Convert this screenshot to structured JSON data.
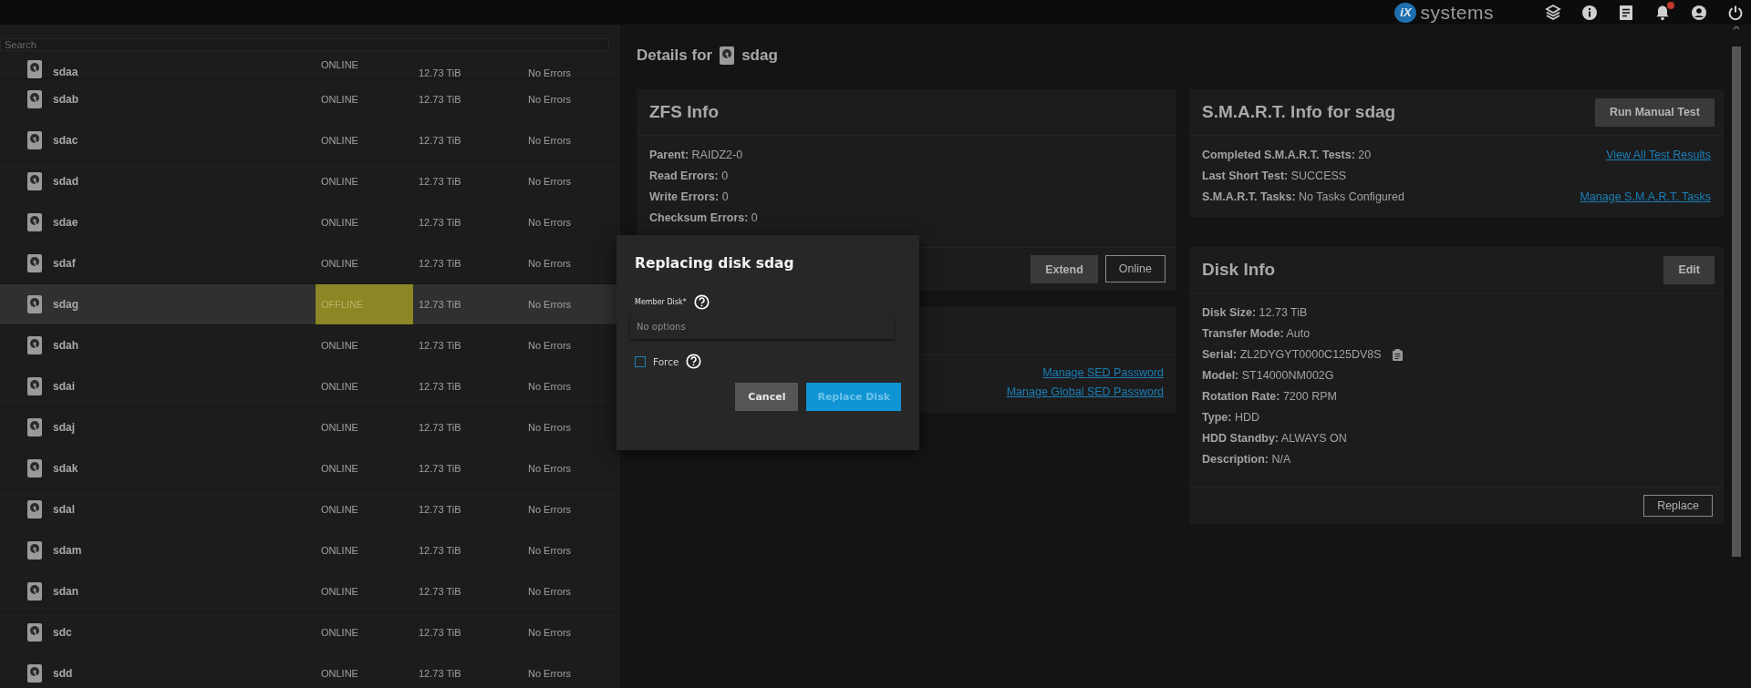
{
  "topbar": {
    "logo_mark": "iX",
    "logo_text": "systems",
    "notification_badge": true
  },
  "disk_list": {
    "search": {
      "placeholder": "Search"
    },
    "rows": [
      {
        "name": "sdaa",
        "status": "ONLINE",
        "size": "12.73 TiB",
        "errors": "No Errors",
        "selected": false,
        "alert": false
      },
      {
        "name": "sdab",
        "status": "ONLINE",
        "size": "12.73 TiB",
        "errors": "No Errors",
        "selected": false,
        "alert": false
      },
      {
        "name": "sdac",
        "status": "ONLINE",
        "size": "12.73 TiB",
        "errors": "No Errors",
        "selected": false,
        "alert": false
      },
      {
        "name": "sdad",
        "status": "ONLINE",
        "size": "12.73 TiB",
        "errors": "No Errors",
        "selected": false,
        "alert": false
      },
      {
        "name": "sdae",
        "status": "ONLINE",
        "size": "12.73 TiB",
        "errors": "No Errors",
        "selected": false,
        "alert": false
      },
      {
        "name": "sdaf",
        "status": "ONLINE",
        "size": "12.73 TiB",
        "errors": "No Errors",
        "selected": false,
        "alert": false
      },
      {
        "name": "sdag",
        "status": "OFFLINE",
        "size": "12.73 TiB",
        "errors": "No Errors",
        "selected": true,
        "alert": true
      },
      {
        "name": "sdah",
        "status": "ONLINE",
        "size": "12.73 TiB",
        "errors": "No Errors",
        "selected": false,
        "alert": false
      },
      {
        "name": "sdai",
        "status": "ONLINE",
        "size": "12.73 TiB",
        "errors": "No Errors",
        "selected": false,
        "alert": false
      },
      {
        "name": "sdaj",
        "status": "ONLINE",
        "size": "12.73 TiB",
        "errors": "No Errors",
        "selected": false,
        "alert": false
      },
      {
        "name": "sdak",
        "status": "ONLINE",
        "size": "12.73 TiB",
        "errors": "No Errors",
        "selected": false,
        "alert": false
      },
      {
        "name": "sdal",
        "status": "ONLINE",
        "size": "12.73 TiB",
        "errors": "No Errors",
        "selected": false,
        "alert": false
      },
      {
        "name": "sdam",
        "status": "ONLINE",
        "size": "12.73 TiB",
        "errors": "No Errors",
        "selected": false,
        "alert": false
      },
      {
        "name": "sdan",
        "status": "ONLINE",
        "size": "12.73 TiB",
        "errors": "No Errors",
        "selected": false,
        "alert": false
      },
      {
        "name": "sdc",
        "status": "ONLINE",
        "size": "12.73 TiB",
        "errors": "No Errors",
        "selected": false,
        "alert": false
      },
      {
        "name": "sdd",
        "status": "ONLINE",
        "size": "12.73 TiB",
        "errors": "No Errors",
        "selected": false,
        "alert": false
      }
    ]
  },
  "details": {
    "title": "Details for",
    "disk": "sdag"
  },
  "zfs_info": {
    "title": "ZFS Info",
    "fields": [
      {
        "label": "Parent:",
        "value": "RAIDZ2-0"
      },
      {
        "label": "Read Errors:",
        "value": "0"
      },
      {
        "label": "Write Errors:",
        "value": "0"
      },
      {
        "label": "Checksum Errors:",
        "value": "0"
      }
    ],
    "buttons": [
      {
        "label": "Extend",
        "kind": "filled"
      },
      {
        "label": "Online",
        "kind": "outline"
      }
    ]
  },
  "sed_card": {
    "links": [
      "Manage SED Password",
      "Manage Global SED Password"
    ]
  },
  "smart_info": {
    "title": "S.M.A.R.T. Info for sdag",
    "button": "Run Manual Test",
    "fields": [
      {
        "label": "Completed S.M.A.R.T. Tests:",
        "value": "20",
        "link": "View All Test Results"
      },
      {
        "label": "Last Short Test:",
        "value": "SUCCESS"
      },
      {
        "label": "S.M.A.R.T. Tasks:",
        "value": "No Tasks Configured",
        "link": "Manage S.M.A.R.T. Tasks"
      }
    ]
  },
  "disk_info": {
    "title": "Disk Info",
    "button": "Edit",
    "fields": [
      {
        "label": "Disk Size:",
        "value": "12.73 TiB"
      },
      {
        "label": "Transfer Mode:",
        "value": "Auto"
      },
      {
        "label": "Serial:",
        "value": "ZL2DYGYT0000C125DV8S",
        "copy": true
      },
      {
        "label": "Model:",
        "value": "ST14000NM002G"
      },
      {
        "label": "Rotation Rate:",
        "value": "7200 RPM"
      },
      {
        "label": "Type:",
        "value": "HDD"
      },
      {
        "label": "HDD Standby:",
        "value": "ALWAYS ON"
      },
      {
        "label": "Description:",
        "value": "N/A"
      }
    ],
    "footer_button": "Replace"
  },
  "dialog": {
    "title": "Replacing disk sdag",
    "member_disk": {
      "label": "Member Disk",
      "required": "*",
      "value": "No options"
    },
    "force": {
      "label": "Force",
      "checked": false
    },
    "buttons": [
      {
        "label": "Cancel",
        "kind": "secondary"
      },
      {
        "label": "Replace Disk",
        "kind": "primary"
      }
    ]
  }
}
